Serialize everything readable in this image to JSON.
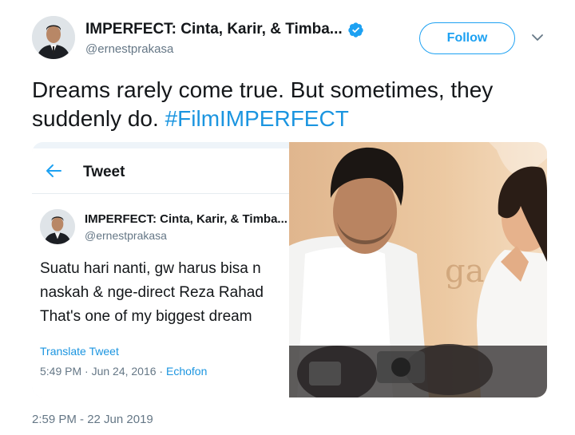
{
  "tweet": {
    "display_name": "IMPERFECT: Cinta, Karir, & Timba...",
    "handle": "@ernestprakasa",
    "follow_label": "Follow",
    "text_main": "Dreams rarely come true. But sometimes, they suddenly do.",
    "hashtag": "#FilmIMPERFECT",
    "timestamp": "2:59 PM - 22 Jun 2019",
    "icons": {
      "verified": "verified-badge-icon",
      "caret": "chevron-down-icon"
    }
  },
  "embedded_screenshot": {
    "header_title": "Tweet",
    "display_name": "IMPERFECT: Cinta, Karir, & Timba...",
    "handle": "@ernestprakasa",
    "text_lines": [
      "Suatu hari nanti, gw harus bisa n",
      "naskah & nge-direct Reza Rahad",
      "That's one of my biggest dream"
    ],
    "translate_label": "Translate Tweet",
    "meta_time": "5:49 PM · Jun 24, 2016 · ",
    "meta_source": "Echofon",
    "icons": {
      "back": "arrow-left-icon"
    }
  },
  "photo": {
    "background_text": "ga"
  },
  "colors": {
    "accent": "#1da1f2",
    "link": "#1b95e0",
    "secondary_text": "#657786",
    "primary_text": "#14171a"
  }
}
